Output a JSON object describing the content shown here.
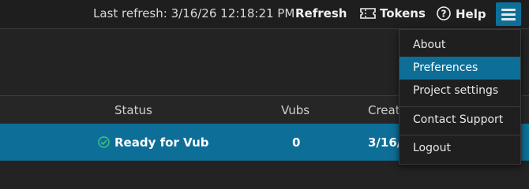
{
  "toolbar": {
    "last_refresh": "Last refresh: 3/16/26 12:18:21 PM",
    "refresh_label": "Refresh",
    "tokens_label": "Tokens",
    "help_label": "Help",
    "menu_icon": "hamburger-icon"
  },
  "table": {
    "columns": [
      "Status",
      "Vubs",
      "Creat"
    ],
    "rows": [
      {
        "status": "Ready for Vub",
        "status_icon": "check-circle-icon",
        "vubs": "0",
        "created": "3/16/"
      }
    ]
  },
  "menu": {
    "items": [
      {
        "label": "About"
      },
      {
        "label": "Preferences",
        "active": true
      },
      {
        "label": "Project settings"
      },
      {
        "label": "Contact Support"
      },
      {
        "label": "Logout"
      }
    ]
  },
  "colors": {
    "accent": "#0d6f98",
    "background": "#232323",
    "status_ok": "#3ec97a"
  }
}
